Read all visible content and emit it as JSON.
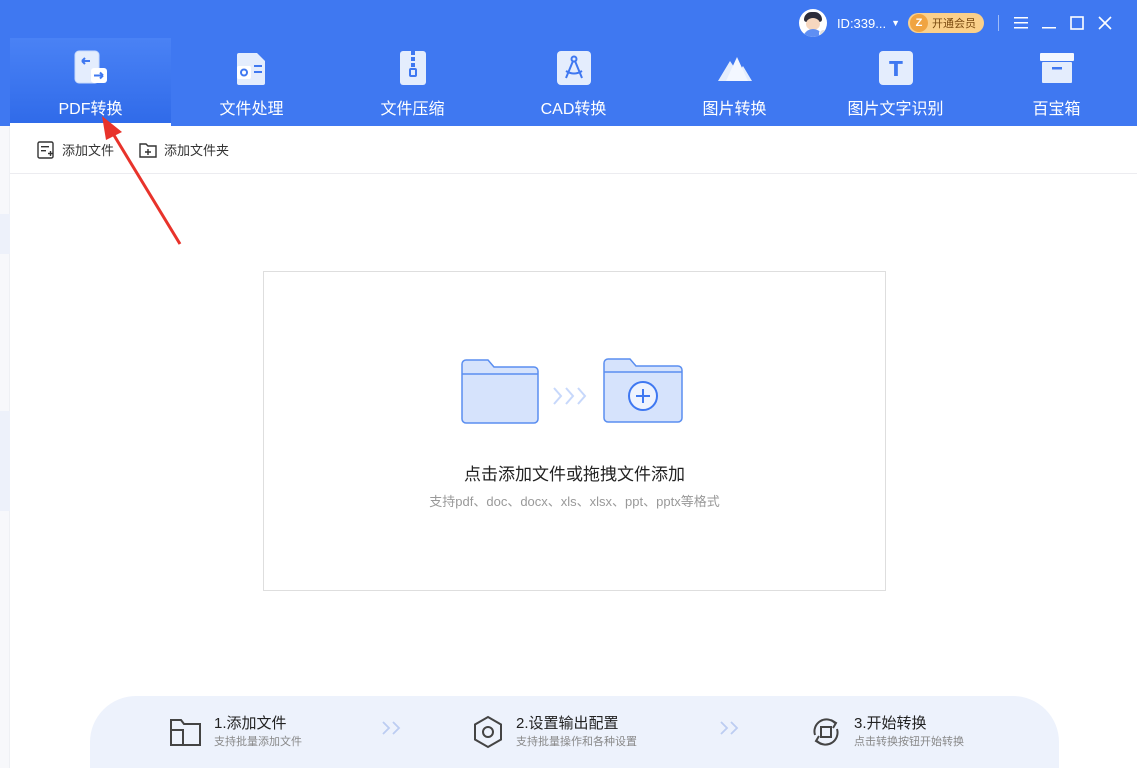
{
  "window": {
    "user_id": "ID:339...",
    "vip_label": "开通会员"
  },
  "tabs": [
    {
      "label": "PDF转换",
      "icon": "pdf-convert-icon",
      "active": true
    },
    {
      "label": "文件处理",
      "icon": "file-process-icon",
      "active": false
    },
    {
      "label": "文件压缩",
      "icon": "file-compress-icon",
      "active": false
    },
    {
      "label": "CAD转换",
      "icon": "cad-convert-icon",
      "active": false
    },
    {
      "label": "图片转换",
      "icon": "image-convert-icon",
      "active": false
    },
    {
      "label": "图片文字识别",
      "icon": "ocr-icon",
      "active": false
    },
    {
      "label": "百宝箱",
      "icon": "toolbox-icon",
      "active": false
    }
  ],
  "toolbar": {
    "add_file": "添加文件",
    "add_folder": "添加文件夹"
  },
  "dropzone": {
    "title": "点击添加文件或拖拽文件添加",
    "subtitle": "支持pdf、doc、docx、xls、xlsx、ppt、pptx等格式"
  },
  "steps": [
    {
      "title": "1.添加文件",
      "desc": "支持批量添加文件"
    },
    {
      "title": "2.设置输出配置",
      "desc": "支持批量操作和各种设置"
    },
    {
      "title": "3.开始转换",
      "desc": "点击转换按钮开始转换"
    }
  ],
  "colors": {
    "header": "#3f78f1",
    "accent": "#3f78f1",
    "annotation_arrow": "#e8332b"
  }
}
